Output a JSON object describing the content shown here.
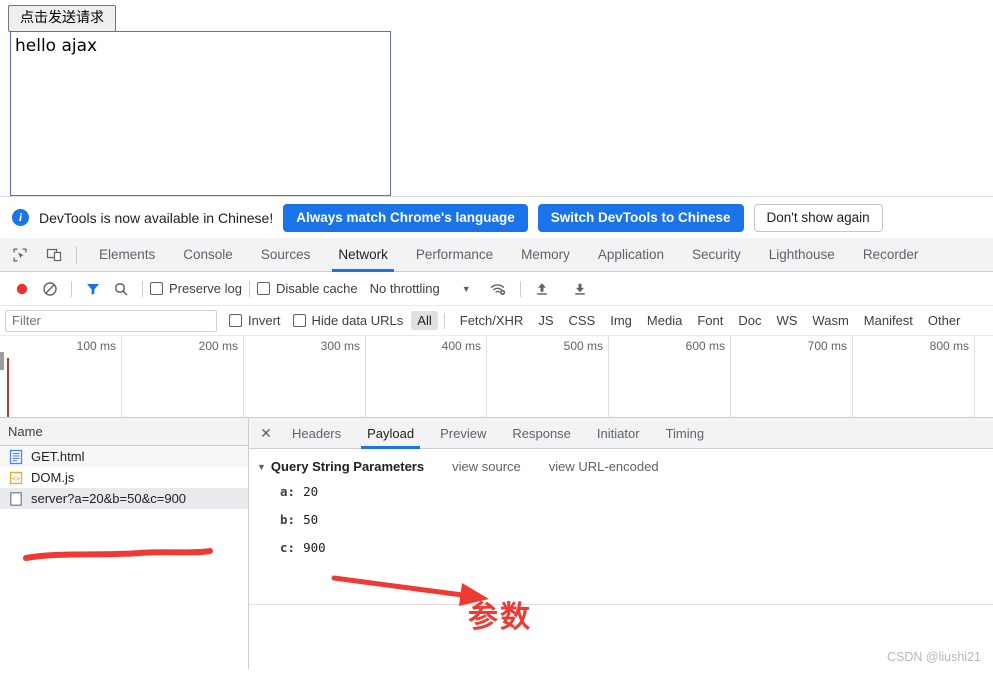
{
  "page": {
    "send_button_label": "点击发送请求",
    "result_text": "hello ajax"
  },
  "notification": {
    "icon": "info-icon",
    "message": "DevTools is now available in Chinese!",
    "primary_button": "Always match Chrome's language",
    "secondary_button": "Switch DevTools to Chinese",
    "dismiss_button": "Don't show again"
  },
  "devtools": {
    "tabs": [
      {
        "label": "Elements",
        "active": false
      },
      {
        "label": "Console",
        "active": false
      },
      {
        "label": "Sources",
        "active": false
      },
      {
        "label": "Network",
        "active": true
      },
      {
        "label": "Performance",
        "active": false
      },
      {
        "label": "Memory",
        "active": false
      },
      {
        "label": "Application",
        "active": false
      },
      {
        "label": "Security",
        "active": false
      },
      {
        "label": "Lighthouse",
        "active": false
      },
      {
        "label": "Recorder",
        "active": false
      }
    ],
    "toolbar": {
      "record_icon": "record-icon",
      "clear_icon": "clear-icon",
      "filter_icon": "filter-icon",
      "search_icon": "search-icon",
      "preserve_log_label": "Preserve log",
      "preserve_log_checked": false,
      "disable_cache_label": "Disable cache",
      "disable_cache_checked": false,
      "throttling_value": "No throttling",
      "wifi_icon": "wifi-settings-icon",
      "import_icon": "import-har-icon",
      "export_icon": "export-har-icon"
    },
    "filterbar": {
      "filter_placeholder": "Filter",
      "filter_value": "",
      "invert_label": "Invert",
      "invert_checked": false,
      "hide_data_urls_label": "Hide data URLs",
      "hide_data_urls_checked": false,
      "types": [
        "All",
        "Fetch/XHR",
        "JS",
        "CSS",
        "Img",
        "Media",
        "Font",
        "Doc",
        "WS",
        "Wasm",
        "Manifest",
        "Other"
      ],
      "active_type": "All"
    },
    "overview": {
      "ticks": [
        "100 ms",
        "200 ms",
        "300 ms",
        "400 ms",
        "500 ms",
        "600 ms",
        "700 ms",
        "800 ms"
      ],
      "marker_color": "#c0392b"
    },
    "requests": {
      "column_header": "Name",
      "rows": [
        {
          "name": "GET.html",
          "icon": "document-icon",
          "selected": false
        },
        {
          "name": "DOM.js",
          "icon": "script-icon",
          "selected": false
        },
        {
          "name": "server?a=20&b=50&c=900",
          "icon": "generic-file-icon",
          "selected": true
        }
      ]
    },
    "detail": {
      "close_label": "✕",
      "tabs": [
        {
          "label": "Headers",
          "active": false
        },
        {
          "label": "Payload",
          "active": true
        },
        {
          "label": "Preview",
          "active": false
        },
        {
          "label": "Response",
          "active": false
        },
        {
          "label": "Initiator",
          "active": false
        },
        {
          "label": "Timing",
          "active": false
        }
      ],
      "payload": {
        "section_title": "Query String Parameters",
        "view_source_label": "view source",
        "view_url_encoded_label": "view URL-encoded",
        "params": [
          {
            "key": "a:",
            "value": "20"
          },
          {
            "key": "b:",
            "value": "50"
          },
          {
            "key": "c:",
            "value": "900"
          }
        ]
      }
    }
  },
  "annotations": {
    "label_text": "参数",
    "annotation_color": "#ef3a34"
  },
  "watermark": "CSDN @liushi21"
}
